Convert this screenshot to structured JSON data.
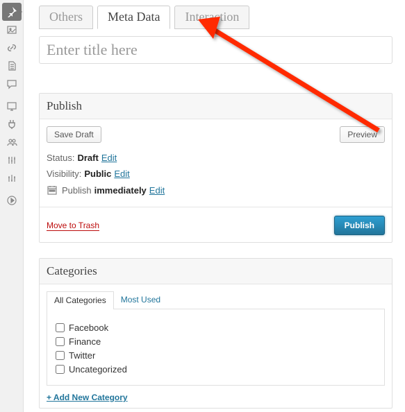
{
  "sidebar": {
    "items": [
      {
        "name": "pin-icon"
      },
      {
        "name": "media-icon"
      },
      {
        "name": "link-icon"
      },
      {
        "name": "page-icon"
      },
      {
        "name": "comment-icon"
      },
      {
        "name": "appearance-icon"
      },
      {
        "name": "plugin-icon"
      },
      {
        "name": "users-icon"
      },
      {
        "name": "tools-icon"
      },
      {
        "name": "settings-icon"
      },
      {
        "name": "collapse-icon"
      }
    ]
  },
  "tabs": [
    {
      "label": "Others"
    },
    {
      "label": "Meta Data"
    },
    {
      "label": "Interaction"
    }
  ],
  "title_placeholder": "Enter title here",
  "publish": {
    "header": "Publish",
    "save_draft": "Save Draft",
    "preview": "Preview",
    "status_label": "Status:",
    "status_value": "Draft",
    "status_edit": "Edit",
    "visibility_label": "Visibility:",
    "visibility_value": "Public",
    "visibility_edit": "Edit",
    "schedule_label": "Publish",
    "schedule_value": "immediately",
    "schedule_edit": "Edit",
    "trash": "Move to Trash",
    "publish_button": "Publish"
  },
  "categories": {
    "header": "Categories",
    "tabs": [
      {
        "label": "All Categories"
      },
      {
        "label": "Most Used"
      }
    ],
    "items": [
      "Facebook",
      "Finance",
      "Twitter",
      "Uncategorized"
    ],
    "add_new": "+ Add New Category"
  }
}
